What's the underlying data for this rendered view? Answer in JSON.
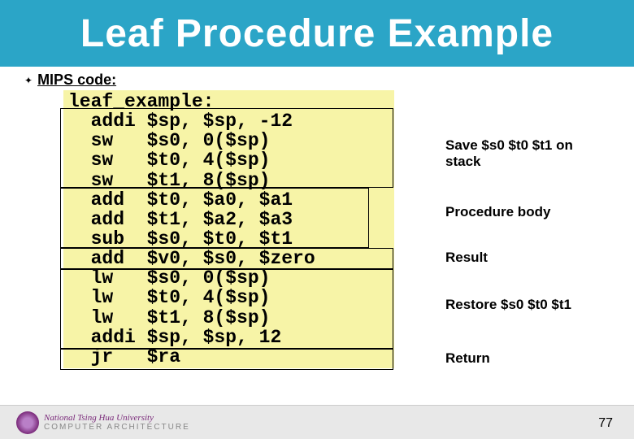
{
  "title": "Leaf Procedure Example",
  "section_label": "MIPS code:",
  "code": "leaf_example:\n  addi $sp, $sp, -12\n  sw   $s0, 0($sp)\n  sw   $t0, 4($sp)\n  sw   $t1, 8($sp)\n  add  $t0, $a0, $a1\n  add  $t1, $a2, $a3\n  sub  $s0, $t0, $t1\n  add  $v0, $s0, $zero\n  lw   $s0, 0($sp)\n  lw   $t0, 4($sp)\n  lw   $t1, 8($sp)\n  addi $sp, $sp, 12\n  jr   $ra",
  "annotations": {
    "save": "Save $s0 $t0 $t1 on stack",
    "body": "Procedure body",
    "result": "Result",
    "restore": "Restore $s0 $t0 $t1",
    "return": "Return"
  },
  "footer": {
    "university": "National Tsing Hua University",
    "dept": "COMPUTER ARCHITECTURE"
  },
  "page_number": "77"
}
